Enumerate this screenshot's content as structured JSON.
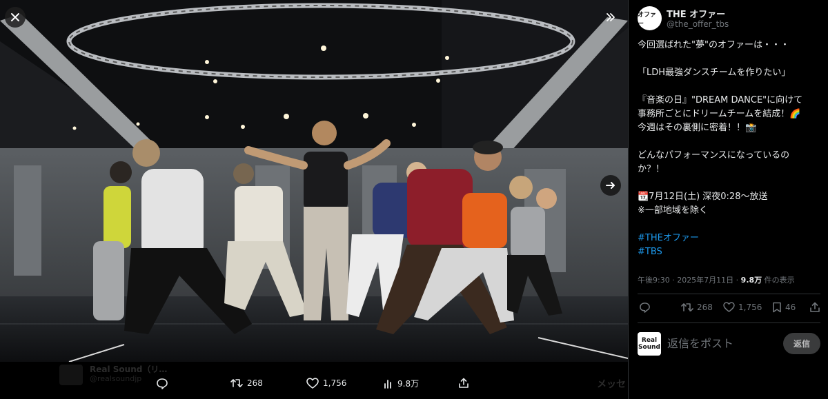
{
  "viewer": {
    "close_icon": "close-icon",
    "expand_icon": "collapse-panel-icon",
    "next_icon": "arrow-right-icon",
    "ghost_name": "Real Sound（リ…",
    "ghost_handle": "@realsoundjp",
    "ghost_right": "メッセ",
    "bar": {
      "reply_icon": "reply-icon",
      "retweets": "268",
      "likes": "1,756",
      "views": "9.8万",
      "share_icon": "share-icon"
    }
  },
  "tweet": {
    "display_name": "THE オファー",
    "handle": "@the_offer_tbs",
    "avatar_text": "オファー",
    "lines": [
      "今回選ばれた\"夢\"のオファーは・・・",
      "",
      "「LDH最強ダンスチームを作りたい」",
      "",
      "『音楽の日』\"DREAM DANCE\"に向けて",
      "事務所ごとにドリームチームを結成！🌈",
      "今週はその裏側に密着！！📸",
      "",
      "どんなパフォーマンスになっているの",
      "か？！",
      "",
      "📆7月12日(土) 深夜0:28〜放送",
      "※一部地域を除く",
      ""
    ],
    "hashtags": [
      "#THEオファー",
      "#TBS"
    ],
    "time": "午後9:30 · 2025年7月11日 · ",
    "views_count": "9.8万",
    "views_label": " 件の表示",
    "retweets": "268",
    "likes": "1,756",
    "bookmarks": "46"
  },
  "reply": {
    "avatar_text": "Real Sound",
    "placeholder": "返信をポスト",
    "button_label": "返信"
  },
  "colors": {
    "accent": "#1d9bf0",
    "muted": "#71767b",
    "background": "#000000"
  }
}
